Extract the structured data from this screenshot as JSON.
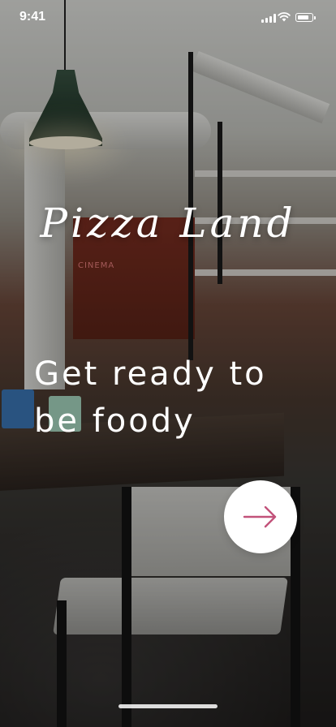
{
  "status_bar": {
    "time": "9:41",
    "icons": [
      "cellular-signal-icon",
      "wifi-icon",
      "battery-icon"
    ],
    "battery_level": 0.85
  },
  "brand": {
    "name": "Pizza Land"
  },
  "headline": {
    "lines": [
      "Get ready to",
      "be foody"
    ]
  },
  "next_button": {
    "icon": "arrow-right-icon",
    "icon_color": "#c2527a",
    "background": "#ffffff"
  }
}
